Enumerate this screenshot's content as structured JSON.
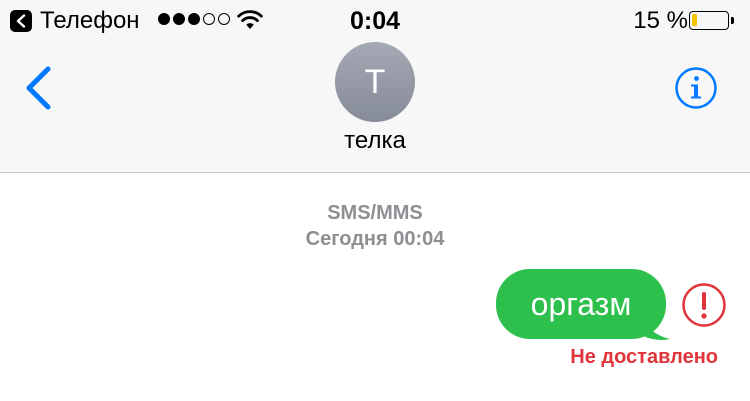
{
  "status_bar": {
    "back_app_label": "Телефон",
    "signal_strength": 3,
    "signal_max": 5,
    "time": "0:04",
    "battery_percent_text": "15 %",
    "battery_level": 0.15,
    "battery_fill_color": "#f5c400",
    "icons": [
      "back-to-app-icon",
      "wifi-icon",
      "battery-icon"
    ]
  },
  "nav": {
    "back_icon": "chevron-left-icon",
    "info_icon": "info-icon",
    "accent_color": "#007aff"
  },
  "contact": {
    "avatar_initial": "Т",
    "name": "телка"
  },
  "conversation": {
    "service": "SMS/MMS",
    "timestamp": "Сегодня 00:04",
    "messages": [
      {
        "direction": "outgoing",
        "text": "оргазм",
        "bubble_color": "#2ec04d",
        "status": "Не доставлено",
        "status_color": "#e0353a",
        "status_icon": "exclamation-circle-icon"
      }
    ]
  }
}
